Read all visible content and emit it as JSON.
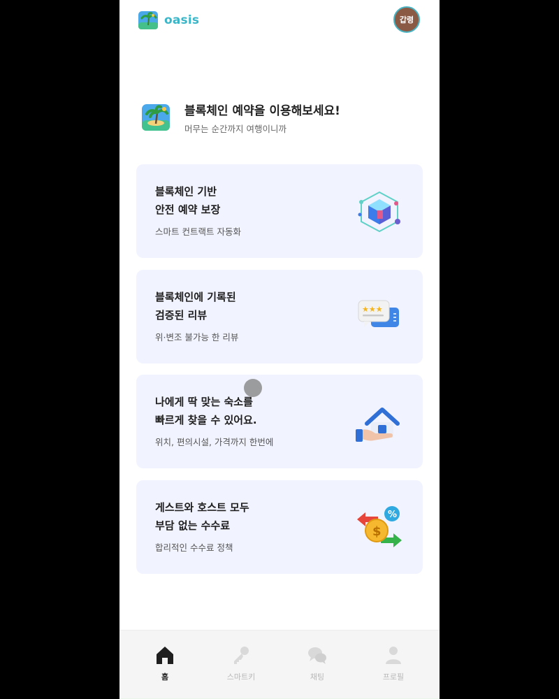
{
  "header": {
    "app_name": "oasis",
    "avatar_text": "갑령"
  },
  "intro": {
    "title": "블록체인 예약을 이용해보세요!",
    "subtitle": "머무는 순간까지 여행이니까"
  },
  "cards": [
    {
      "title_line1": "블록체인 기반",
      "title_line2": "안전 예약 보장",
      "description": "스마트 컨트랙트 자동화",
      "icon": "blockchain-cube-icon"
    },
    {
      "title_line1": "블록체인에 기록된",
      "title_line2": "검증된 리뷰",
      "description": "위·변조 불가능 한 리뷰",
      "icon": "review-chat-icon"
    },
    {
      "title_line1": "나에게 딱 맞는 숙소를",
      "title_line2": "빠르게 찾을 수 있어요.",
      "description": "위치, 편의시설, 가격까지 한번에",
      "icon": "house-hand-icon"
    },
    {
      "title_line1": "게스트와 호스트 모두",
      "title_line2": "부담 없는 수수료",
      "description": "합리적인 수수료 정책",
      "icon": "coin-exchange-icon"
    }
  ],
  "bottom_nav": [
    {
      "label": "홈",
      "icon": "home-icon",
      "active": true
    },
    {
      "label": "스마트키",
      "icon": "key-icon",
      "active": false
    },
    {
      "label": "채팅",
      "icon": "chat-icon",
      "active": false
    },
    {
      "label": "프로필",
      "icon": "profile-icon",
      "active": false
    }
  ],
  "colors": {
    "brand": "#3bb6c8",
    "card_background": "#f1f3ff",
    "nav_active": "#222222",
    "nav_inactive": "#b8b8b8"
  }
}
